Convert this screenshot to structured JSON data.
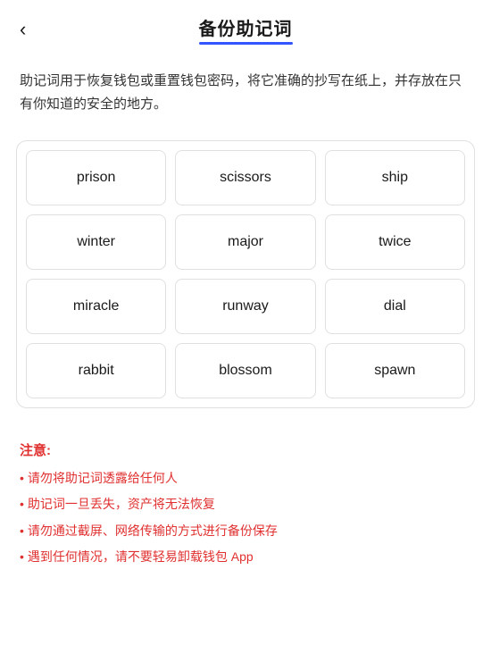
{
  "header": {
    "back_icon": "‹",
    "title": "备份助记词",
    "underline_color": "#3355ff"
  },
  "description": {
    "text": "助记词用于恢复钱包或重置钱包密码，将它准确的抄写在纸上，并存放在只有你知道的安全的地方。"
  },
  "mnemonic": {
    "words": [
      "prison",
      "scissors",
      "ship",
      "winter",
      "major",
      "twice",
      "miracle",
      "runway",
      "dial",
      "rabbit",
      "blossom",
      "spawn"
    ]
  },
  "notice": {
    "title": "注意:",
    "items": [
      "请勿将助记词透露给任何人",
      "助记词一旦丢失，资产将无法恢复",
      "请勿通过截屏、网络传输的方式进行备份保存",
      "遇到任何情况，请不要轻易卸载钱包 App"
    ],
    "bullet": "•"
  }
}
